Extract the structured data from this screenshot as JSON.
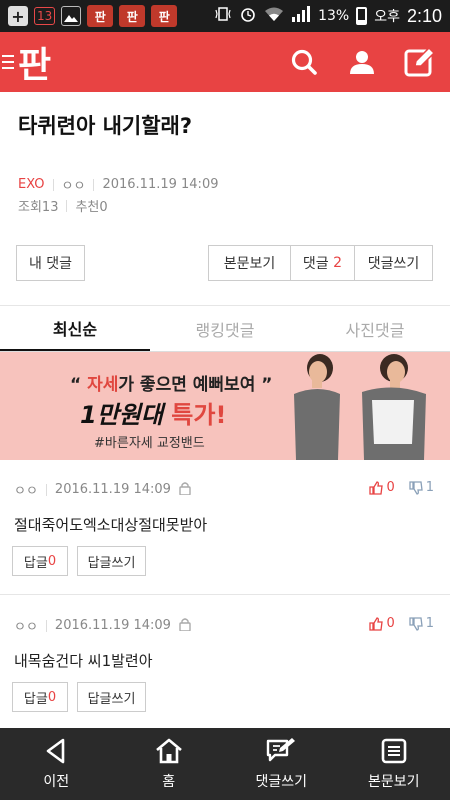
{
  "status_bar": {
    "missed": "13",
    "pan_labels": [
      "판",
      "판",
      "판"
    ],
    "battery": "13%",
    "ampm": "오후",
    "time": "2:10"
  },
  "app": {
    "logo": "판"
  },
  "post": {
    "title": "타퀴련아 내기할래?",
    "category": "EXO",
    "author": "ㅇㅇ",
    "date": "2016.11.19 14:09",
    "views_label": "조회",
    "views": "13",
    "recommend_label": "추천",
    "recommend": "0"
  },
  "actions": {
    "my_comments": "내 댓글",
    "view_post": "본문보기",
    "comments_label": "댓글",
    "comments_count": "2",
    "write_comment": "댓글쓰기"
  },
  "tabs": [
    "최신순",
    "랭킹댓글",
    "사진댓글"
  ],
  "ad": {
    "line1_pre": "“ ",
    "line1_hl": "자세",
    "line1_post": "가 좋으면 예뻐보여 ”",
    "line2_a": "1만원대",
    "line2_b": " 특가!",
    "line3": "#바른자세 교정밴드"
  },
  "comments": [
    {
      "author": "ㅇㅇ",
      "date": "2016.11.19 14:09",
      "up": "0",
      "down": "1",
      "text": "절대죽어도엑소대상절대못받아",
      "reply_label": "답글",
      "reply_count": "0",
      "write_reply": "답글쓰기"
    },
    {
      "author": "ㅇㅇ",
      "date": "2016.11.19 14:09",
      "up": "0",
      "down": "1",
      "text": "내목숨건다 씨1발련아",
      "reply_label": "답글",
      "reply_count": "0",
      "write_reply": "답글쓰기"
    }
  ],
  "bottom_nav": {
    "prev": "이전",
    "home": "홈",
    "write": "댓글쓰기",
    "post": "본문보기"
  }
}
